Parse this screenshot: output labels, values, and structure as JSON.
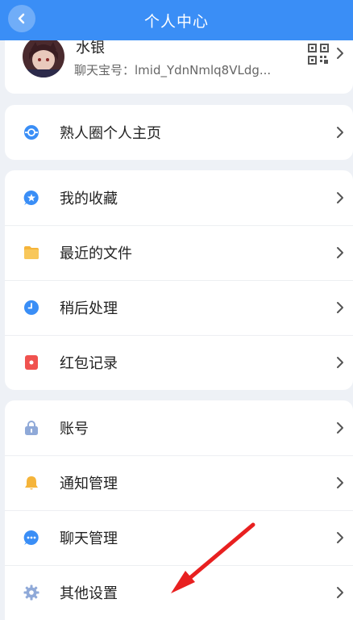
{
  "header": {
    "title": "个人中心"
  },
  "profile": {
    "name": "水银",
    "chat_id": "聊天宝号：lmid_YdnNmlq8VLdg..."
  },
  "groups": [
    {
      "items": [
        {
          "label": "熟人圈个人主页",
          "icon": "circle-link-icon",
          "color": "#3a8ef6"
        }
      ]
    },
    {
      "items": [
        {
          "label": "我的收藏",
          "icon": "star-bubble-icon",
          "color": "#3a8ef6"
        },
        {
          "label": "最近的文件",
          "icon": "folder-icon",
          "color": "#f5b43a"
        },
        {
          "label": "稍后处理",
          "icon": "clock-icon",
          "color": "#3a8ef6"
        },
        {
          "label": "红包记录",
          "icon": "red-envelope-icon",
          "color": "#f0524f"
        }
      ]
    },
    {
      "items": [
        {
          "label": "账号",
          "icon": "lock-icon",
          "color": "#8fa9d8"
        },
        {
          "label": "通知管理",
          "icon": "bell-icon",
          "color": "#f5b43a"
        },
        {
          "label": "聊天管理",
          "icon": "chat-bubble-icon",
          "color": "#3a8ef6"
        },
        {
          "label": "其他设置",
          "icon": "gear-icon",
          "color": "#8fa9d8"
        }
      ]
    }
  ],
  "annotation": {
    "arrow_color": "#e82020"
  }
}
